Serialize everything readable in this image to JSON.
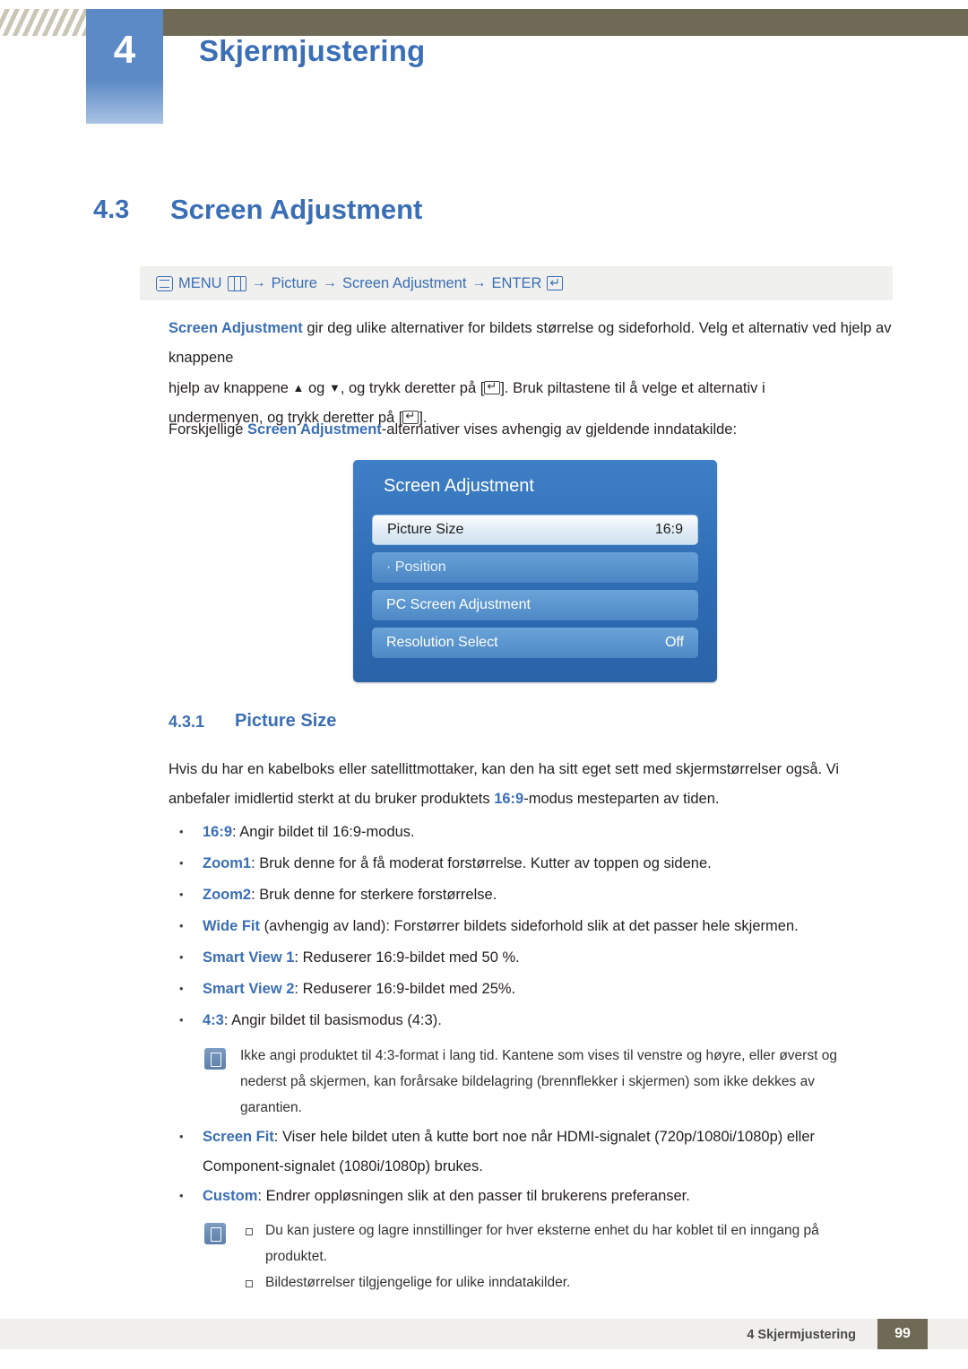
{
  "header": {
    "chapter_number": "4",
    "chapter_title": "Skjermjustering"
  },
  "section": {
    "number": "4.3",
    "title": "Screen Adjustment"
  },
  "menu_path": {
    "menu_label": "MENU",
    "arrow1": "→",
    "item1": "Picture",
    "arrow2": "→",
    "item2": "Screen Adjustment",
    "arrow3": "→",
    "enter_label": "ENTER"
  },
  "intro": {
    "p1_bold": "Screen Adjustment",
    "p1_rest": " gir deg ulike alternativer for bildets størrelse og sideforhold. Velg et alternativ ved hjelp av knappene",
    "p1_line2_mid": " og ",
    "p1_line2_rest": ", og trykk deretter på [",
    "p1_line2_tail": "]. Bruk piltastene til å velge et alternativ i",
    "p1_line3": "undermenyen, og trykk deretter på [",
    "p1_line3_tail": "].",
    "p2_pre": "Forskjellige ",
    "p2_bold": "Screen Adjustment",
    "p2_post": "-alternativer vises avhengig av gjeldende inndatakilde:"
  },
  "osd": {
    "title": "Screen Adjustment",
    "rows": [
      {
        "label": "Picture Size",
        "value": "16:9"
      },
      {
        "label": "· Position",
        "value": ""
      },
      {
        "label": "PC Screen Adjustment",
        "value": ""
      },
      {
        "label": "Resolution Select",
        "value": "Off"
      }
    ]
  },
  "subsection": {
    "number": "4.3.1",
    "title": "Picture Size"
  },
  "body": {
    "para_line1": "Hvis du har en kabelboks eller satellittmottaker, kan den ha sitt eget sett med skjermstørrelser også. Vi",
    "para_line2_pre": "anbefaler imidlertid sterkt at du bruker produktets ",
    "para_line2_bold": "16:9",
    "para_line2_post": "-modus mesteparten av tiden."
  },
  "bullets": [
    {
      "term": "16:9",
      "rest": ": Angir bildet til 16:9-modus."
    },
    {
      "term": "Zoom1",
      "rest": ": Bruk denne for å få moderat forstørrelse. Kutter av toppen og sidene."
    },
    {
      "term": "Zoom2",
      "rest": ": Bruk denne for sterkere forstørrelse."
    },
    {
      "term": "Wide Fit",
      "rest": " (avhengig av land): Forstørrer bildets sideforhold slik at det passer hele skjermen."
    },
    {
      "term": "Smart View 1",
      "rest": ": Reduserer 16:9-bildet med 50 %."
    },
    {
      "term": "Smart View 2",
      "rest": ": Reduserer 16:9-bildet med 25%."
    },
    {
      "term": "4:3",
      "rest": ": Angir bildet til basismodus (4:3)."
    }
  ],
  "note1": {
    "line1": "Ikke angi produktet til 4:3-format i lang tid. Kantene som vises til venstre og høyre, eller øverst og",
    "line2": "nederst på skjermen, kan forårsake bildelagring (brennflekker i skjermen) som ikke dekkes av",
    "line3": "garantien."
  },
  "bullets2": [
    {
      "term": "Screen Fit",
      "rest": ": Viser hele bildet uten å kutte bort noe når HDMI-signalet (720p/1080i/1080p) eller",
      "rest2": "Component-signalet (1080i/1080p) brukes."
    },
    {
      "term": "Custom",
      "rest": ": Endrer oppløsningen slik at den passer til brukerens preferanser."
    }
  ],
  "note2": {
    "line1": "Du kan justere og lagre innstillinger for hver eksterne enhet du har koblet til en inngang på",
    "line2": "produktet.",
    "line3": "Bildestørrelser tilgjengelige for ulike inndatakilder."
  },
  "footer": {
    "text": "4 Skjermjustering",
    "page": "99"
  },
  "colors": {
    "accent_blue": "#3a6eb5",
    "header_olive": "#6f6a55",
    "osd_blue": "#2e6cb4"
  }
}
